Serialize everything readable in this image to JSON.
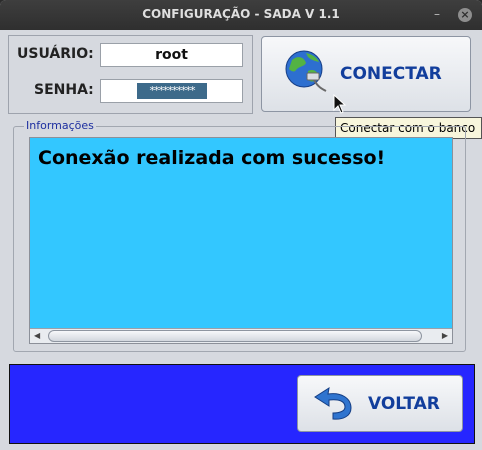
{
  "window": {
    "title": "CONFIGURAÇÃO - SADA V 1.1"
  },
  "login": {
    "user_label": "USUÁRIO:",
    "user_value": "root",
    "password_label": "SENHA:",
    "password_value": "**********"
  },
  "connect": {
    "label": "CONECTAR",
    "icon": "globe-network-icon",
    "tooltip": "Conectar com o banco"
  },
  "info": {
    "legend": "Informações",
    "message": "Conexão realizada com sucesso!",
    "background_color": "#33c7ff"
  },
  "back": {
    "label": "VOLTAR",
    "icon": "undo-arrow-icon"
  },
  "colors": {
    "accent_text": "#123e9c",
    "bottom_panel": "#2626ff"
  }
}
